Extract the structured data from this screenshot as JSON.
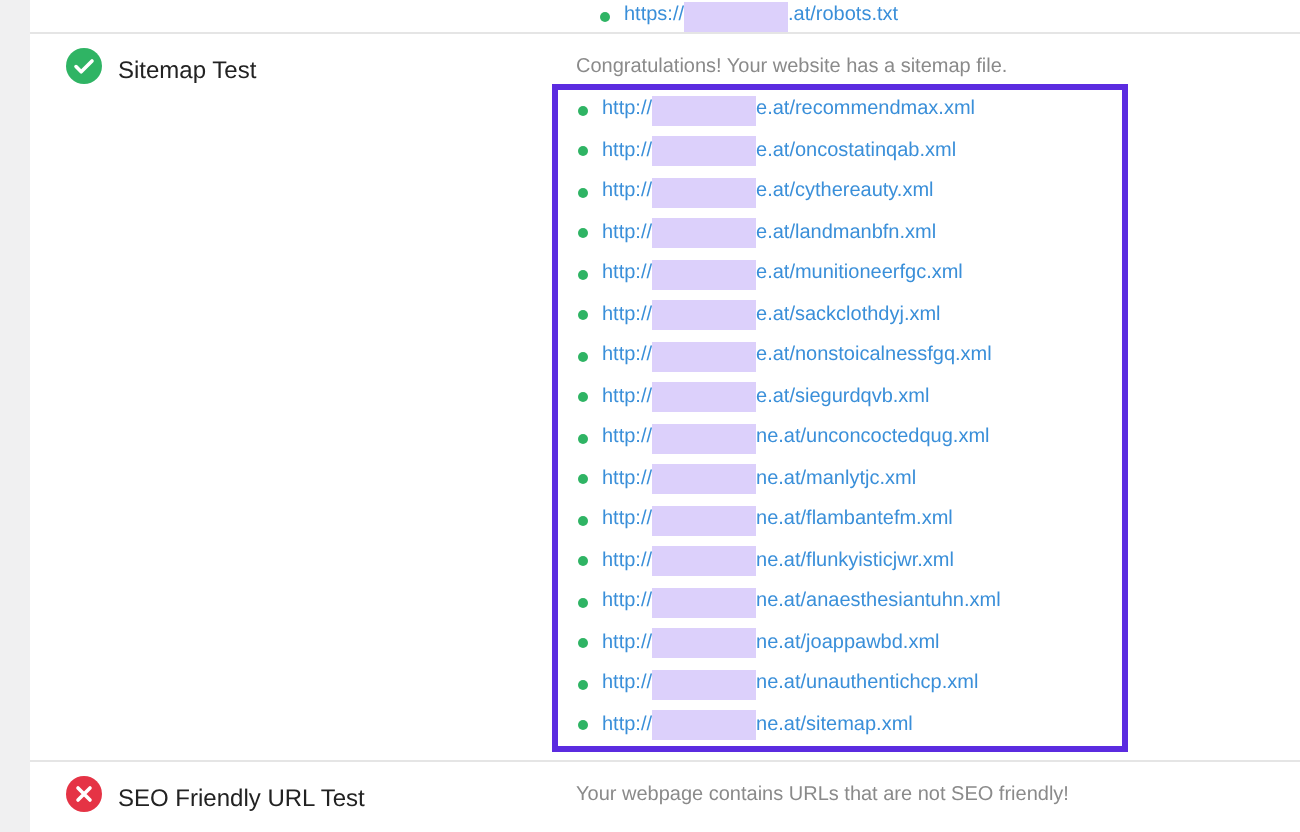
{
  "previous_row": {
    "url": {
      "prefix": "https://",
      "suffix": ".at/robots.txt"
    }
  },
  "tests": [
    {
      "name": "Sitemap Test",
      "passed": true,
      "message": "Congratulations! Your website has a sitemap file.",
      "urls": [
        {
          "prefix": "http://",
          "suffix": "e.at/recommendmax.xml"
        },
        {
          "prefix": "http://",
          "suffix": "e.at/oncostatinqab.xml"
        },
        {
          "prefix": "http://",
          "suffix": "e.at/cythereauty.xml"
        },
        {
          "prefix": "http://",
          "suffix": "e.at/landmanbfn.xml"
        },
        {
          "prefix": "http://",
          "suffix": "e.at/munitioneerfgc.xml"
        },
        {
          "prefix": "http://",
          "suffix": "e.at/sackclothdyj.xml"
        },
        {
          "prefix": "http://",
          "suffix": "e.at/nonstoicalnessfgq.xml"
        },
        {
          "prefix": "http://",
          "suffix": "e.at/siegurdqvb.xml"
        },
        {
          "prefix": "http://",
          "suffix": "ne.at/unconcoctedqug.xml"
        },
        {
          "prefix": "http://",
          "suffix": "ne.at/manlytjc.xml"
        },
        {
          "prefix": "http://",
          "suffix": "ne.at/flambantefm.xml"
        },
        {
          "prefix": "http://",
          "suffix": "ne.at/flunkyisticjwr.xml"
        },
        {
          "prefix": "http://",
          "suffix": "ne.at/anaesthesiantuhn.xml"
        },
        {
          "prefix": "http://",
          "suffix": "ne.at/joappawbd.xml"
        },
        {
          "prefix": "http://",
          "suffix": "ne.at/unauthentichcp.xml"
        },
        {
          "prefix": "http://",
          "suffix": "ne.at/sitemap.xml"
        }
      ]
    },
    {
      "name": "SEO Friendly URL Test",
      "passed": false,
      "message": "Your webpage contains URLs that are not SEO friendly!"
    }
  ]
}
